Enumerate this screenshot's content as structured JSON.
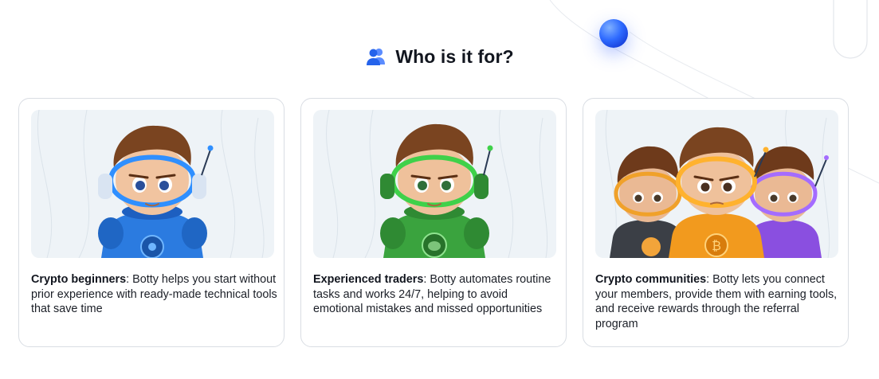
{
  "section": {
    "title": "Who is it for?",
    "title_icon": "users-icon"
  },
  "cards": [
    {
      "illustration": "blue-astronaut-boy-illustration",
      "title": "Crypto beginners",
      "text": ": Botty helps you start without prior experience with ready-made technical tools that save time"
    },
    {
      "illustration": "green-astronaut-boy-illustration",
      "title": "Experienced traders",
      "text": ": Botty automates routine tasks and works 24/7, helping to avoid emotional mistakes and missed opportunities"
    },
    {
      "illustration": "group-of-astronaut-boys-illustration",
      "title": "Crypto communities",
      "text": ": Botty lets you connect your members, provide them with earning tools, and receive rewards through the referral program"
    }
  ],
  "colors": {
    "accent": "#2f6bff",
    "card_border": "#d9dde3",
    "illustration_bg": "#eef3f7",
    "blue_suit": "#2b7be0",
    "green_suit": "#3aa33e",
    "orange_suit": "#f29a1e",
    "purple_suit": "#8a4fe0",
    "black_suit": "#3b3f46"
  }
}
